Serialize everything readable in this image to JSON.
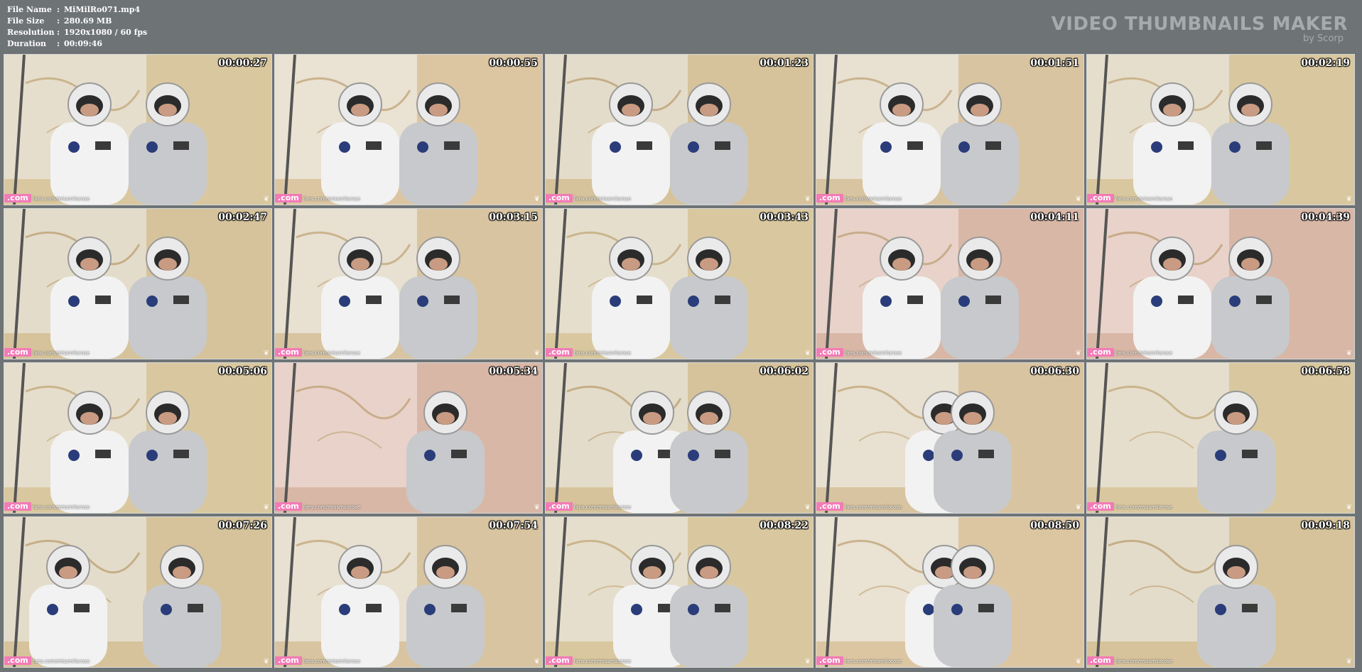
{
  "file_info": {
    "rows": [
      {
        "label": "File Name",
        "value": "MiMilRo071.mp4"
      },
      {
        "label": "File Size",
        "value": "280.69 MB"
      },
      {
        "label": "Resolution",
        "value": "1920x1080 / 60 fps"
      },
      {
        "label": "Duration",
        "value": "00:09:46"
      }
    ]
  },
  "brand": {
    "title": "VIDEO THUMBNAILS MAKER",
    "subtitle": "by Scorp"
  },
  "watermark": {
    "logo": ".com",
    "url": "fans.com/missmilarose"
  },
  "corner_icon": "❦",
  "thumbnails": [
    {
      "time": "00:00:27"
    },
    {
      "time": "00:00:55"
    },
    {
      "time": "00:01:23"
    },
    {
      "time": "00:01:51"
    },
    {
      "time": "00:02:19"
    },
    {
      "time": "00:02:47"
    },
    {
      "time": "00:03:15"
    },
    {
      "time": "00:03:43"
    },
    {
      "time": "00:04:11"
    },
    {
      "time": "00:04:39"
    },
    {
      "time": "00:05:06"
    },
    {
      "time": "00:05:34"
    },
    {
      "time": "00:06:02"
    },
    {
      "time": "00:06:30"
    },
    {
      "time": "00:06:58"
    },
    {
      "time": "00:07:26"
    },
    {
      "time": "00:07:54"
    },
    {
      "time": "00:08:22"
    },
    {
      "time": "00:08:50"
    },
    {
      "time": "00:09:18"
    }
  ]
}
